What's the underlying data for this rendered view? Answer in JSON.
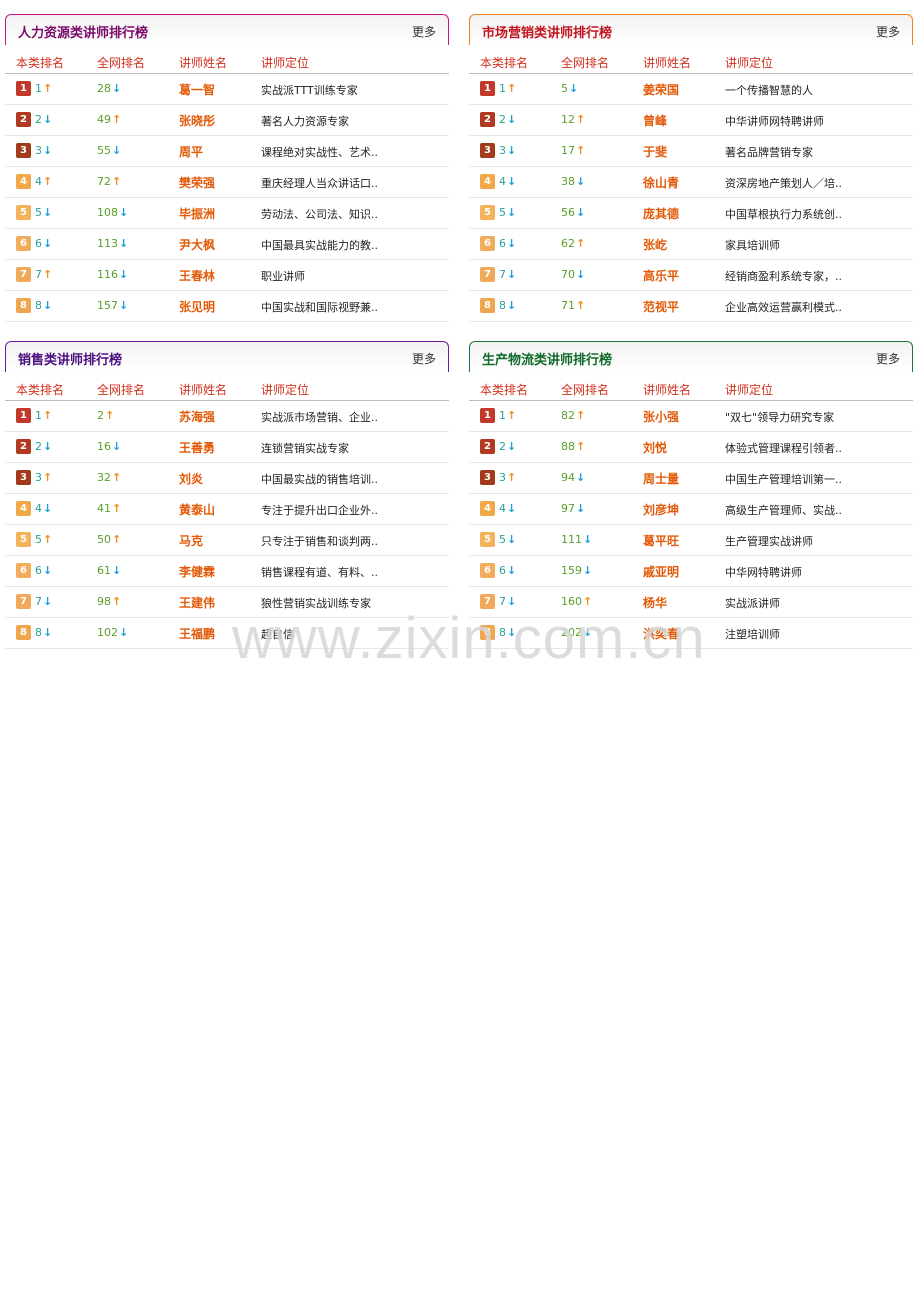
{
  "columns": {
    "cat_rank": "本类排名",
    "net_rank": "全网排名",
    "name": "讲师姓名",
    "position": "讲师定位"
  },
  "more_label": "更多",
  "watermark": "www.zixin.com.cn",
  "badge_colors": [
    "#c0392b",
    "#b03a22",
    "#a33a1a",
    "#f0a848",
    "#f3b35a",
    "#f2ad5c",
    "#f0a85a",
    "#f0a64e"
  ],
  "panels": [
    {
      "title": "人力资源类讲师排行榜",
      "accent": "#c71585",
      "title_color": "#7a0a6a",
      "rows": [
        {
          "cat": "1",
          "cat_dir": "up",
          "net": "28",
          "net_dir": "down",
          "name": "葛一智",
          "pos": "实战派TTT训练专家"
        },
        {
          "cat": "2",
          "cat_dir": "down",
          "net": "49",
          "net_dir": "up",
          "name": "张晓彤",
          "pos": "著名人力资源专家"
        },
        {
          "cat": "3",
          "cat_dir": "down",
          "net": "55",
          "net_dir": "down",
          "name": "周平",
          "pos": "课程绝对实战性、艺术.."
        },
        {
          "cat": "4",
          "cat_dir": "up",
          "net": "72",
          "net_dir": "up",
          "name": "樊荣强",
          "pos": "重庆经理人当众讲话口.."
        },
        {
          "cat": "5",
          "cat_dir": "down",
          "net": "108",
          "net_dir": "down",
          "name": "毕振洲",
          "pos": "劳动法、公司法、知识.."
        },
        {
          "cat": "6",
          "cat_dir": "down",
          "net": "113",
          "net_dir": "down",
          "name": "尹大枫",
          "pos": "中国最具实战能力的教.."
        },
        {
          "cat": "7",
          "cat_dir": "up",
          "net": "116",
          "net_dir": "down",
          "name": "王春林",
          "pos": "职业讲师"
        },
        {
          "cat": "8",
          "cat_dir": "down",
          "net": "157",
          "net_dir": "down",
          "name": "张见明",
          "pos": "中国实战和国际视野兼.."
        }
      ]
    },
    {
      "title": "市场营销类讲师排行榜",
      "accent": "#f0821e",
      "title_color": "#c0141e",
      "rows": [
        {
          "cat": "1",
          "cat_dir": "up",
          "net": "5",
          "net_dir": "down",
          "name": "姜荣国",
          "pos": "一个传播智慧的人"
        },
        {
          "cat": "2",
          "cat_dir": "down",
          "net": "12",
          "net_dir": "up",
          "name": "曾峰",
          "pos": "中华讲师网特聘讲师"
        },
        {
          "cat": "3",
          "cat_dir": "down",
          "net": "17",
          "net_dir": "up",
          "name": "于斐",
          "pos": "著名品牌营销专家"
        },
        {
          "cat": "4",
          "cat_dir": "down",
          "net": "38",
          "net_dir": "down",
          "name": "徐山青",
          "pos": "资深房地产策划人／培.."
        },
        {
          "cat": "5",
          "cat_dir": "down",
          "net": "56",
          "net_dir": "down",
          "name": "庞其德",
          "pos": "中国草根执行力系统创.."
        },
        {
          "cat": "6",
          "cat_dir": "down",
          "net": "62",
          "net_dir": "up",
          "name": "张屹",
          "pos": "家具培训师"
        },
        {
          "cat": "7",
          "cat_dir": "down",
          "net": "70",
          "net_dir": "down",
          "name": "高乐平",
          "pos": "经销商盈利系统专家，.."
        },
        {
          "cat": "8",
          "cat_dir": "down",
          "net": "71",
          "net_dir": "up",
          "name": "范视平",
          "pos": "企业高效运营赢利模式.."
        }
      ]
    },
    {
      "title": "销售类讲师排行榜",
      "accent": "#6a1b9a",
      "title_color": "#4b0f82",
      "rows": [
        {
          "cat": "1",
          "cat_dir": "up",
          "net": "2",
          "net_dir": "up",
          "name": "苏海强",
          "pos": "实战派市场营销、企业.."
        },
        {
          "cat": "2",
          "cat_dir": "down",
          "net": "16",
          "net_dir": "down",
          "name": "王善勇",
          "pos": "连锁营销实战专家"
        },
        {
          "cat": "3",
          "cat_dir": "up",
          "net": "32",
          "net_dir": "up",
          "name": "刘炎",
          "pos": "中国最实战的销售培训.."
        },
        {
          "cat": "4",
          "cat_dir": "down",
          "net": "41",
          "net_dir": "up",
          "name": "黄泰山",
          "pos": "专注于提升出口企业外.."
        },
        {
          "cat": "5",
          "cat_dir": "up",
          "net": "50",
          "net_dir": "up",
          "name": "马克",
          "pos": "只专注于销售和谈判两.."
        },
        {
          "cat": "6",
          "cat_dir": "down",
          "net": "61",
          "net_dir": "down",
          "name": "李健霖",
          "pos": "销售课程有道、有料、.."
        },
        {
          "cat": "7",
          "cat_dir": "down",
          "net": "98",
          "net_dir": "up",
          "name": "王建伟",
          "pos": "狼性营销实战训练专家"
        },
        {
          "cat": "8",
          "cat_dir": "down",
          "net": "102",
          "net_dir": "down",
          "name": "王福鹏",
          "pos": "超自信"
        }
      ]
    },
    {
      "title": "生产物流类讲师排行榜",
      "accent": "#1b7a3a",
      "title_color": "#0f6a2a",
      "rows": [
        {
          "cat": "1",
          "cat_dir": "up",
          "net": "82",
          "net_dir": "up",
          "name": "张小强",
          "pos": "\"双七\"领导力研究专家"
        },
        {
          "cat": "2",
          "cat_dir": "down",
          "net": "88",
          "net_dir": "up",
          "name": "刘悦",
          "pos": "体验式管理课程引领者.."
        },
        {
          "cat": "3",
          "cat_dir": "up",
          "net": "94",
          "net_dir": "down",
          "name": "周士量",
          "pos": "中国生产管理培训第一.."
        },
        {
          "cat": "4",
          "cat_dir": "down",
          "net": "97",
          "net_dir": "down",
          "name": "刘彦坤",
          "pos": "高级生产管理师、实战.."
        },
        {
          "cat": "5",
          "cat_dir": "down",
          "net": "111",
          "net_dir": "down",
          "name": "葛平旺",
          "pos": "生产管理实战讲师"
        },
        {
          "cat": "6",
          "cat_dir": "down",
          "net": "159",
          "net_dir": "down",
          "name": "戚亚明",
          "pos": "中华网特聘讲师"
        },
        {
          "cat": "7",
          "cat_dir": "down",
          "net": "160",
          "net_dir": "up",
          "name": "杨华",
          "pos": "实战派讲师"
        },
        {
          "cat": "8",
          "cat_dir": "down",
          "net": "202",
          "net_dir": "down",
          "name": "洪奕春",
          "pos": "注塑培训师"
        }
      ]
    }
  ]
}
